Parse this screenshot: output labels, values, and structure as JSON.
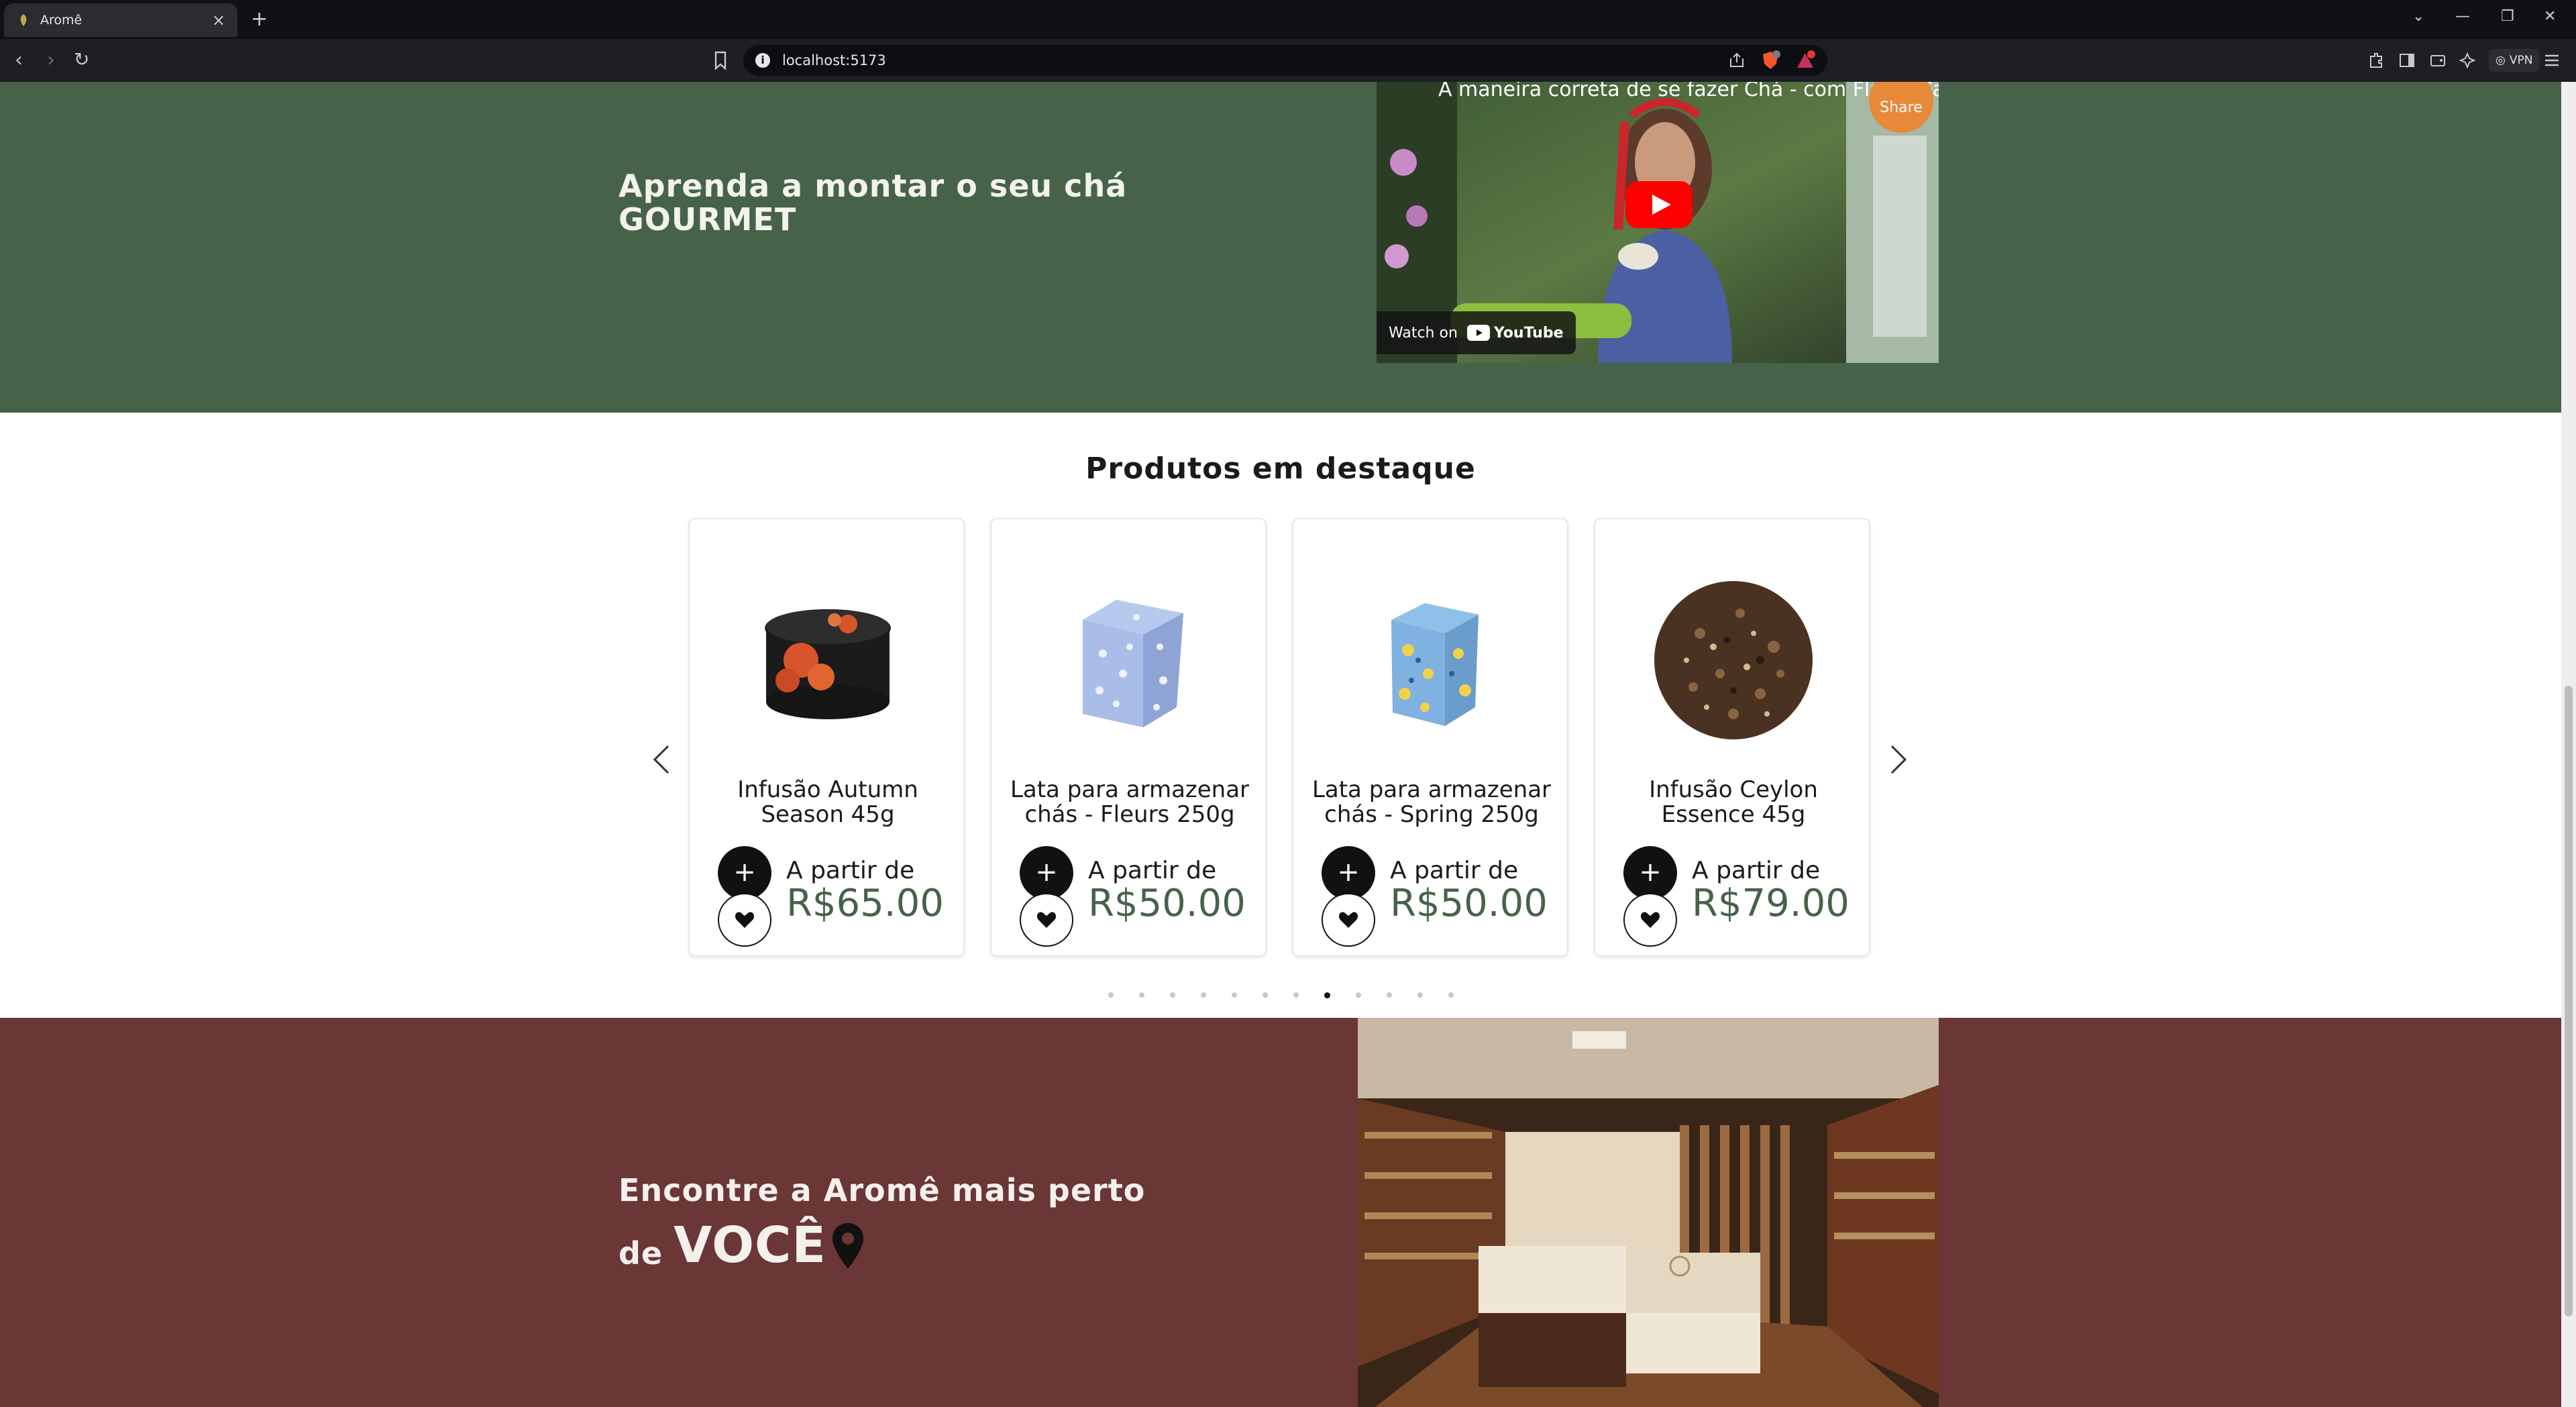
{
  "browser": {
    "tab_title": "Aromê",
    "url": "localhost:5173",
    "vpn_label": "VPN",
    "brave_badge": "3",
    "rewards_badge": "2"
  },
  "hero": {
    "title_line1": "Aprenda a montar o seu chá",
    "title_line2": "GOURMET",
    "video_title": "A maneira correta de se fazer Chá - com Flavia Ca...",
    "share_label": "Share",
    "watch_on": "Watch on",
    "youtube": "YouTube"
  },
  "featured": {
    "title": "Produtos em destaque",
    "products": [
      {
        "name": "Infusão Autumn Season 45g",
        "from_label": "A partir de",
        "price": "R$65.00",
        "image": "tin-autumn"
      },
      {
        "name": "Lata para armazenar chás - Fleurs 250g",
        "from_label": "A partir de",
        "price": "R$50.00",
        "image": "tin-fleurs"
      },
      {
        "name": "Lata para armazenar chás - Spring 250g",
        "from_label": "A partir de",
        "price": "R$50.00",
        "image": "tin-spring"
      },
      {
        "name": "Infusão Ceylon Essence 45g",
        "from_label": "A partir de",
        "price": "R$79.00",
        "image": "loose-tea"
      }
    ],
    "carousel": {
      "dot_count": 12,
      "active_index": 7
    }
  },
  "store": {
    "title_line1": "Encontre a Aromê mais perto",
    "title_line2_prefix": "de",
    "title_line2_emphasis": "VOCÊ"
  },
  "colors": {
    "hero_bg": "#46634a",
    "store_bg": "#6a3636",
    "price": "#46634a"
  }
}
